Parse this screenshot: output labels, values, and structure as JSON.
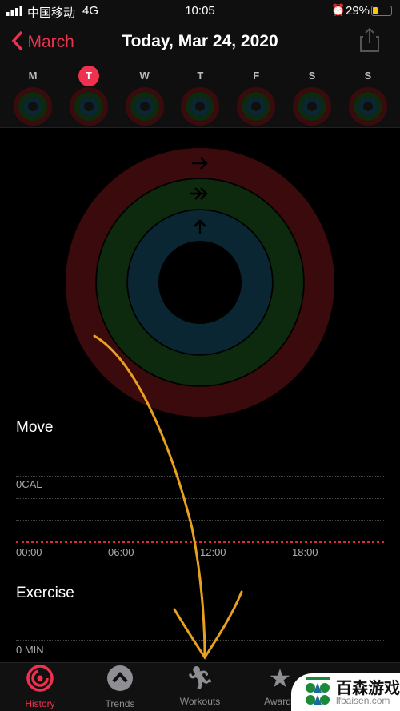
{
  "status": {
    "carrier": "中国移动",
    "network": "4G",
    "time": "10:05",
    "battery": "29%"
  },
  "header": {
    "back_label": "March",
    "title": "Today, Mar 24, 2020",
    "share_icon": "share-icon"
  },
  "week": {
    "days": [
      "M",
      "T",
      "W",
      "T",
      "F",
      "S",
      "S"
    ],
    "selected_index": 1
  },
  "rings": {
    "colors": {
      "move": "#3a0a0c",
      "exercise": "#0d2a0e",
      "stand": "#0b2633"
    },
    "move": 0,
    "exercise": 0,
    "stand": 0
  },
  "move": {
    "label": "Move",
    "value": "0CAL",
    "times": [
      "00:00",
      "06:00",
      "12:00",
      "18:00"
    ]
  },
  "exercise": {
    "label": "Exercise",
    "value": "0 MIN"
  },
  "tabs": [
    {
      "label": "History",
      "icon": "history-rings-icon"
    },
    {
      "label": "Trends",
      "icon": "trends-icon"
    },
    {
      "label": "Workouts",
      "icon": "running-figure-icon"
    },
    {
      "label": "Awards",
      "icon": "award-star-icon"
    }
  ],
  "watermark": {
    "name": "百森游戏",
    "url": "lfbaisen.com"
  },
  "accent": "#f0304f"
}
